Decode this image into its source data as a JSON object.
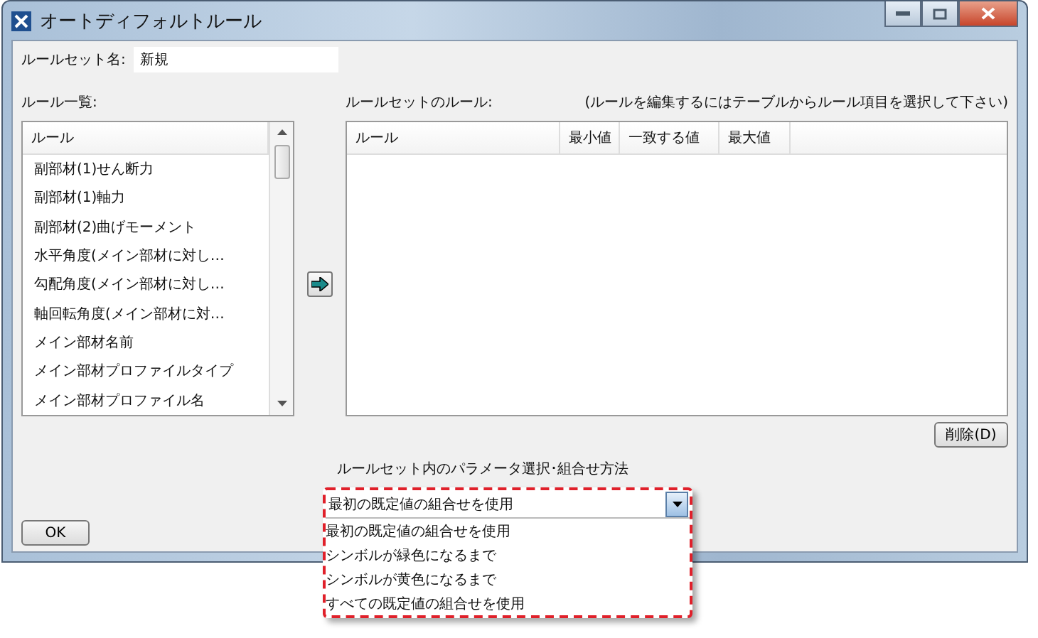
{
  "window": {
    "title": "オートディフォルトルール"
  },
  "rule_set_name": {
    "label": "ルールセット名:",
    "value": "新規"
  },
  "rule_list": {
    "label": "ルール一覧:",
    "column": "ルール",
    "items": [
      "副部材(1)せん断力",
      "副部材(1)軸力",
      "副部材(2)曲げモーメント",
      "水平角度(メイン部材に対し…",
      "勾配角度(メイン部材に対し…",
      "軸回転角度(メイン部材に対…",
      "メイン部材名前",
      "メイン部材プロファイルタイプ",
      "メイン部材プロファイル名"
    ]
  },
  "rule_set_rules": {
    "label": "ルールセットのルール:",
    "hint": "(ルールを編集するにはテーブルからルール項目を選択して下さい)",
    "columns": [
      "ルール",
      "最小値",
      "一致する値",
      "最大値"
    ]
  },
  "delete_button": "削除(D)",
  "combination": {
    "label": "ルールセット内のパラメータ選択･組合せ方法",
    "value": "最初の既定値の組合せを使用",
    "expanded": true,
    "options": [
      "最初の既定値の組合せを使用",
      "シンボルが緑色になるまで",
      "シンボルが黄色になるまで",
      "すべての既定値の組合せを使用"
    ]
  },
  "ok_button": "OK"
}
